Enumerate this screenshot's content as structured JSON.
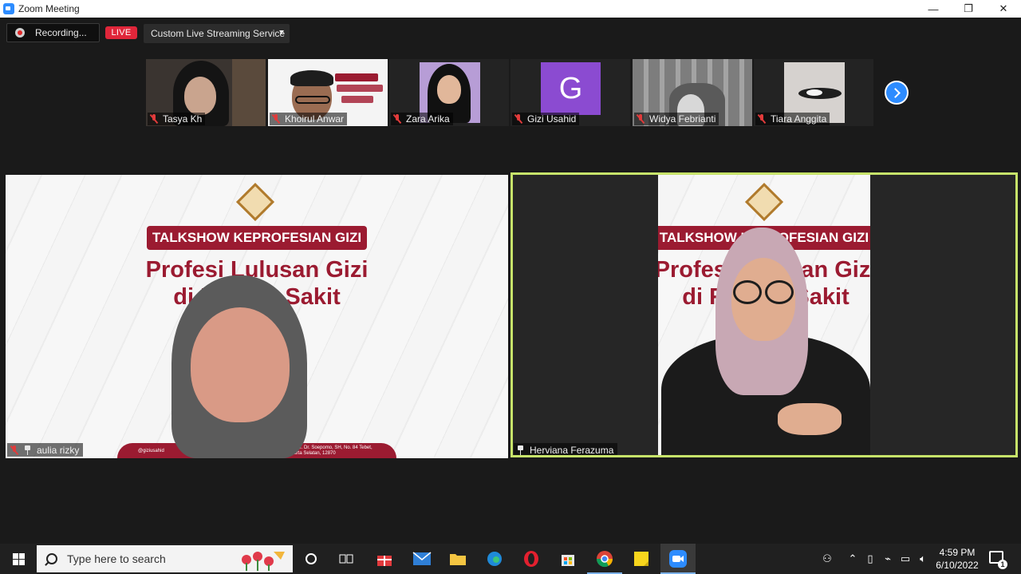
{
  "window": {
    "title": "Zoom Meeting",
    "minimize": "—",
    "restore": "❐",
    "close": "✕"
  },
  "toolbar": {
    "recording_label": "Recording...",
    "live_label": "LIVE",
    "stream_label": "Custom Live Streaming Service"
  },
  "participants": [
    {
      "name": "Tasya Kh",
      "muted": true
    },
    {
      "name": "Khoirul Anwar",
      "muted": true
    },
    {
      "name": "Zara Arika",
      "muted": true
    },
    {
      "name": "Gizi Usahid",
      "muted": true,
      "avatar_letter": "G"
    },
    {
      "name": "Widya Febrianti",
      "muted": true
    },
    {
      "name": "Tiara Anggita",
      "muted": true
    }
  ],
  "main_videos": {
    "left": {
      "name": "aulia rizky",
      "banner": "TALKSHOW KEPROFESIAN GIZI",
      "title_line1": "Profesi Lulusan Gizi",
      "title_line2": "di Rumah Sakit",
      "footer_left": "@giziusahid",
      "footer_right": "Jl. Prof. Dr. Soepomo, SH, No. 84 Tebet, Jakarta Selatan, 12870"
    },
    "right": {
      "name": "Herviana Ferazuma",
      "banner": "TALKSHOW KEPROFESIAN GIZI",
      "title_line1": "Profesi Lulusan Gizi",
      "title_line2": "di Rumah Sakit"
    }
  },
  "taskbar": {
    "search_placeholder": "Type here to search",
    "time": "4:59 PM",
    "date": "6/10/2022",
    "notification_count": "1"
  },
  "colors": {
    "accent": "#2d8cff",
    "live": "#e0263a",
    "active_speaker_border": "#c7e36a",
    "brand_maroon": "#9b1b31"
  }
}
